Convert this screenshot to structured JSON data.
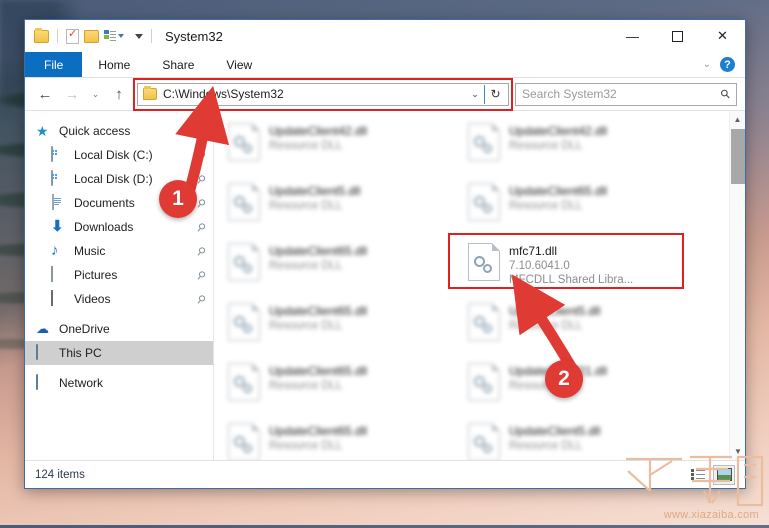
{
  "window": {
    "title": "System32",
    "quick_access_toolbar": [
      {
        "name": "folder-icon",
        "label": "Properties folder"
      },
      {
        "name": "properties-icon",
        "label": "Properties"
      },
      {
        "name": "new-folder-icon",
        "label": "New folder"
      },
      {
        "name": "customize-icon",
        "label": "Customize Quick Access Toolbar"
      }
    ],
    "controls": {
      "minimize": "—",
      "maximize": "☐",
      "close": "✕"
    }
  },
  "ribbon": {
    "tabs": [
      {
        "label": "File",
        "active": true
      },
      {
        "label": "Home",
        "active": false
      },
      {
        "label": "Share",
        "active": false
      },
      {
        "label": "View",
        "active": false
      }
    ],
    "collapse_icon": "chevron-down-icon",
    "help_label": "?"
  },
  "addressbar": {
    "back_icon": "←",
    "forward_icon": "→",
    "recent_icon": "⌄",
    "up_icon": "↑",
    "path": "C:\\Windows\\System32",
    "dropdown_icon": "⌄",
    "refresh_icon": "↻",
    "highlighted": true
  },
  "search": {
    "placeholder": "Search System32",
    "icon": "search-icon"
  },
  "sidebar": {
    "items": [
      {
        "label": "Quick access",
        "icon": "star-icon",
        "pinned": false,
        "indent": false,
        "selected": false
      },
      {
        "label": "Local Disk (C:)",
        "icon": "disk-icon",
        "pinned": true,
        "indent": true,
        "selected": false
      },
      {
        "label": "Local Disk (D:)",
        "icon": "disk-icon",
        "pinned": true,
        "indent": true,
        "selected": false
      },
      {
        "label": "Documents",
        "icon": "document-icon",
        "pinned": true,
        "indent": true,
        "selected": false
      },
      {
        "label": "Downloads",
        "icon": "download-icon",
        "pinned": true,
        "indent": true,
        "selected": false
      },
      {
        "label": "Music",
        "icon": "music-icon",
        "pinned": true,
        "indent": true,
        "selected": false
      },
      {
        "label": "Pictures",
        "icon": "picture-icon",
        "pinned": true,
        "indent": true,
        "selected": false
      },
      {
        "label": "Videos",
        "icon": "video-icon",
        "pinned": true,
        "indent": true,
        "selected": false
      },
      {
        "label": "OneDrive",
        "icon": "cloud-icon",
        "pinned": false,
        "indent": false,
        "selected": false
      },
      {
        "label": "This PC",
        "icon": "pc-icon",
        "pinned": false,
        "indent": false,
        "selected": true
      },
      {
        "label": "Network",
        "icon": "network-icon",
        "pinned": false,
        "indent": false,
        "selected": false
      }
    ]
  },
  "files": [
    {
      "name": "UpdateClient42.dll",
      "line2": "Resource DLL",
      "line3": "",
      "blurred": true,
      "highlighted": false
    },
    {
      "name": "UpdateClient42.dll",
      "line2": "Resource DLL",
      "line3": "",
      "blurred": true,
      "highlighted": false
    },
    {
      "name": "UpdateClient5.dll",
      "line2": "Resource DLL",
      "line3": "",
      "blurred": true,
      "highlighted": false
    },
    {
      "name": "UpdateClient65.dll",
      "line2": "Resource DLL",
      "line3": "",
      "blurred": true,
      "highlighted": false
    },
    {
      "name": "UpdateClient65.dll",
      "line2": "Resource DLL",
      "line3": "",
      "blurred": true,
      "highlighted": false
    },
    {
      "name": "mfc71.dll",
      "line2": "7.10.6041.0",
      "line3": "MFCDLL Shared Libra...",
      "blurred": false,
      "highlighted": true
    },
    {
      "name": "UpdateClient65.dll",
      "line2": "Resource DLL",
      "line3": "",
      "blurred": true,
      "highlighted": false
    },
    {
      "name": "UpdateClient5.dll",
      "line2": "Resource DLL",
      "line3": "",
      "blurred": true,
      "highlighted": false
    },
    {
      "name": "UpdateClient65.dll",
      "line2": "Resource DLL",
      "line3": "",
      "blurred": true,
      "highlighted": false
    },
    {
      "name": "UpdateClient21.dll",
      "line2": "Resource DLL",
      "line3": "",
      "blurred": true,
      "highlighted": false
    },
    {
      "name": "UpdateClient65.dll",
      "line2": "Resource DLL",
      "line3": "",
      "blurred": true,
      "highlighted": false
    },
    {
      "name": "UpdateClient5.dll",
      "line2": "Resource DLL",
      "line3": "",
      "blurred": true,
      "highlighted": false
    }
  ],
  "statusbar": {
    "item_count": "124 items",
    "view_details_icon": "details-view-icon",
    "view_large_icon": "large-icons-view-icon"
  },
  "annotations": [
    {
      "number": "1",
      "target": "address-bar"
    },
    {
      "number": "2",
      "target": "mfc71-dll-file"
    }
  ],
  "watermark": {
    "url": "www.xiazaiba.com",
    "logo": "下载吧"
  },
  "colors": {
    "accent": "#0b6ec1",
    "annotation_red": "#e03a34",
    "highlight_red": "#e02020",
    "selection_gray": "#cfcfcf"
  }
}
